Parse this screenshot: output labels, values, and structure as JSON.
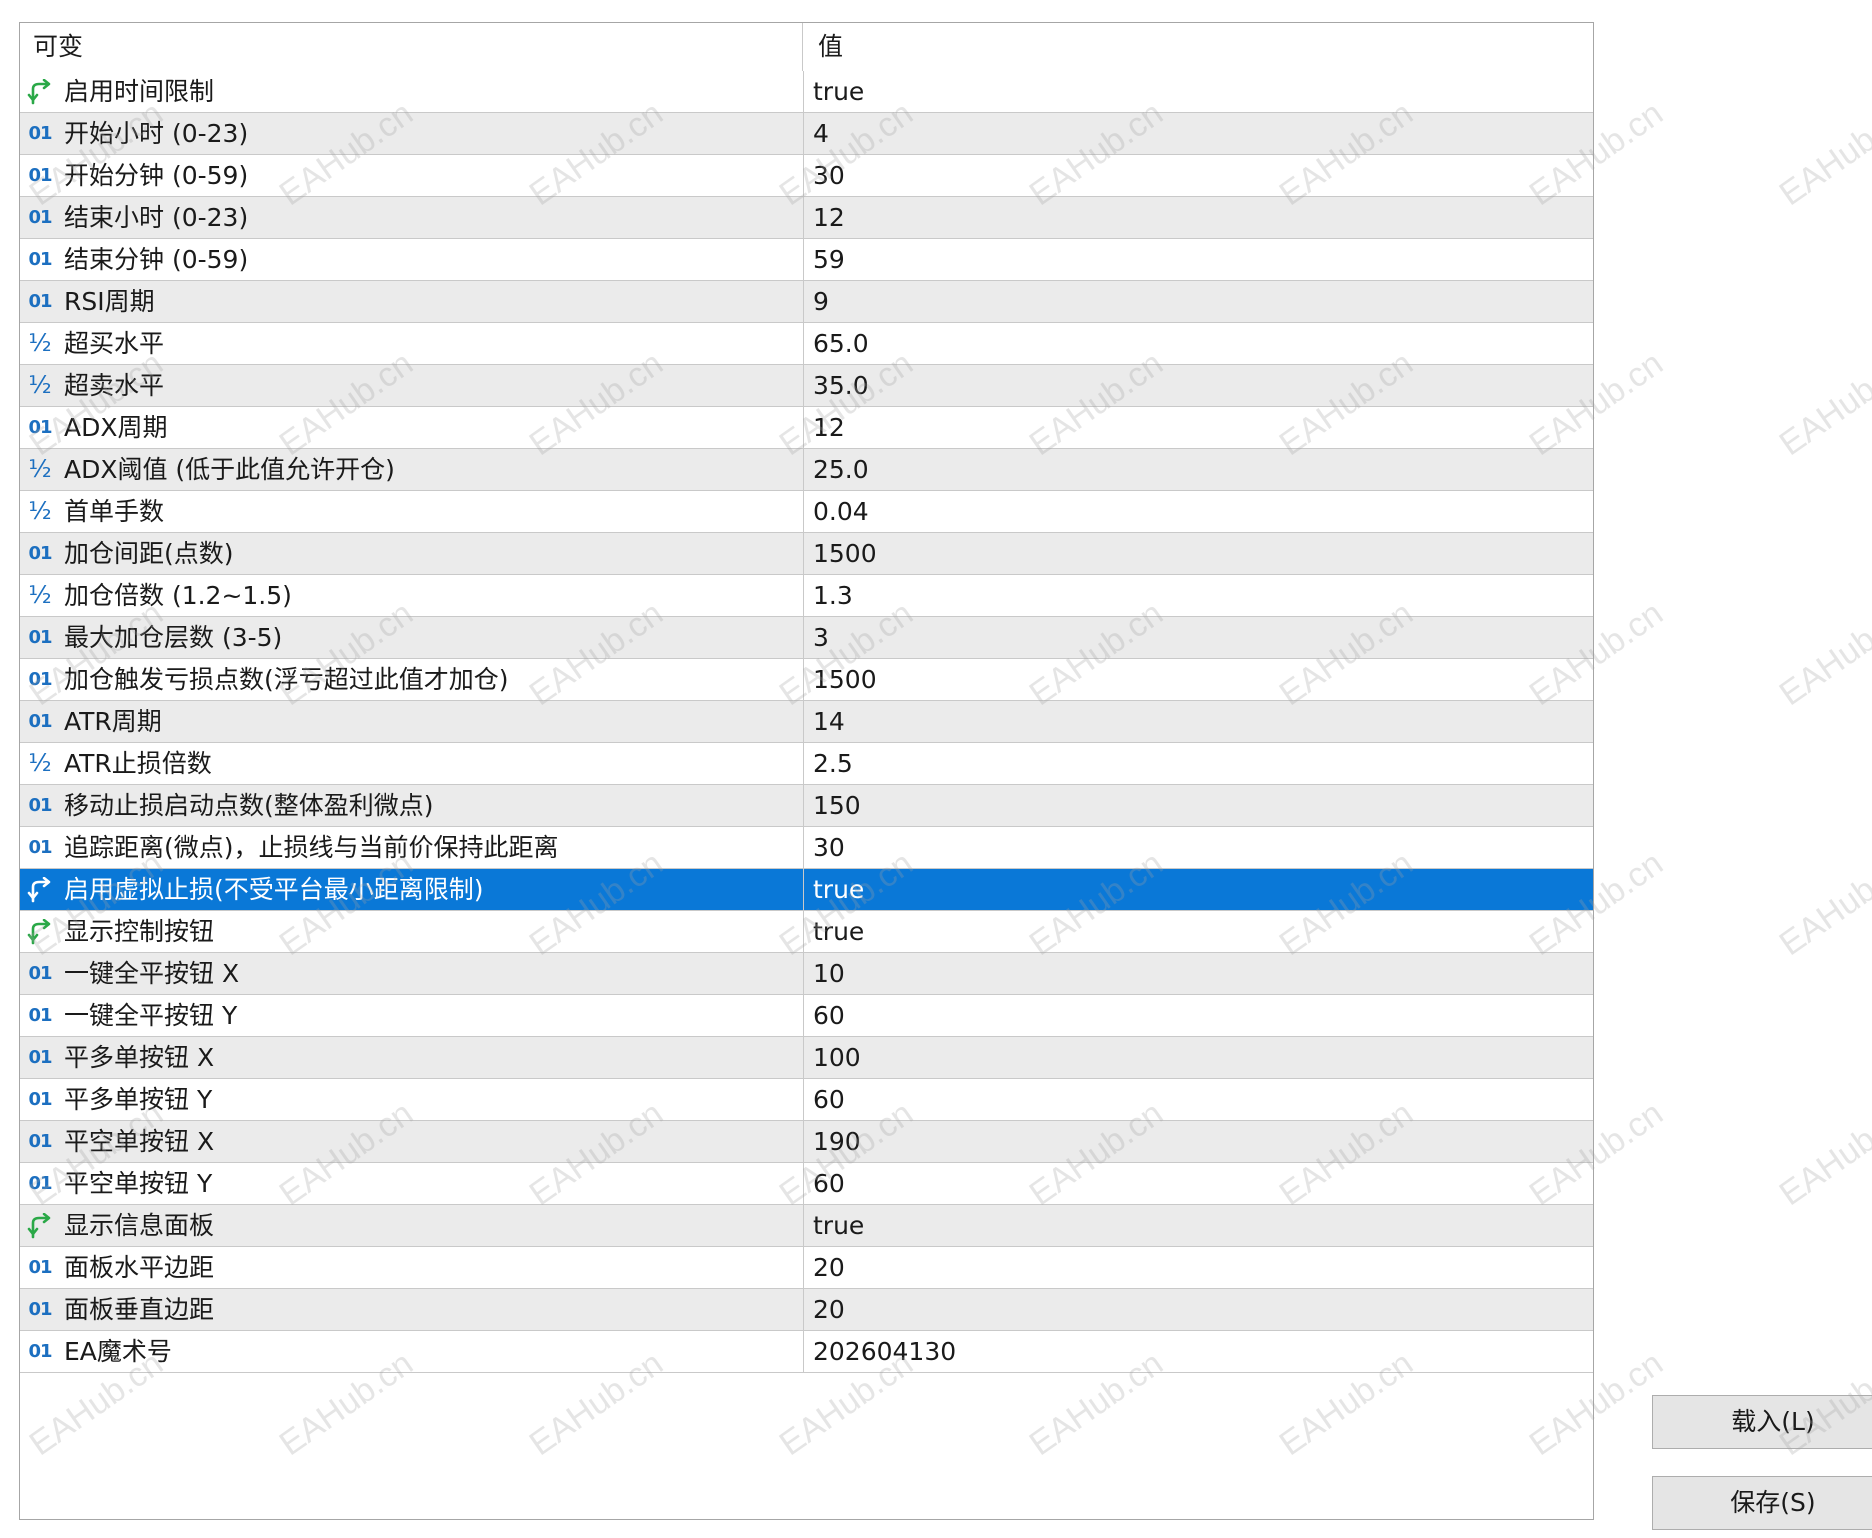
{
  "header": {
    "col_name": "可变",
    "col_value": "值"
  },
  "watermark": "EAHub.cn",
  "colors": {
    "selection": "#0a78d7",
    "alt_row": "#ebebeb",
    "bool_icon": "#2aa847",
    "num_icon": "#1c6fc0"
  },
  "selected_row_index": 19,
  "params": [
    {
      "icon": "bool-icon",
      "name": "启用时间限制",
      "value": "true"
    },
    {
      "icon": "int-icon",
      "name": "开始小时 (0-23)",
      "value": "4"
    },
    {
      "icon": "int-icon",
      "name": "开始分钟 (0-59)",
      "value": "30"
    },
    {
      "icon": "int-icon",
      "name": "结束小时 (0-23)",
      "value": "12"
    },
    {
      "icon": "int-icon",
      "name": "结束分钟 (0-59)",
      "value": "59"
    },
    {
      "icon": "int-icon",
      "name": "RSI周期",
      "value": "9"
    },
    {
      "icon": "double-icon",
      "name": "超买水平",
      "value": "65.0"
    },
    {
      "icon": "double-icon",
      "name": "超卖水平",
      "value": "35.0"
    },
    {
      "icon": "int-icon",
      "name": "ADX周期",
      "value": "12"
    },
    {
      "icon": "double-icon",
      "name": "ADX阈值 (低于此值允许开仓)",
      "value": "25.0"
    },
    {
      "icon": "double-icon",
      "name": "首单手数",
      "value": "0.04"
    },
    {
      "icon": "int-icon",
      "name": "加仓间距(点数)",
      "value": "1500"
    },
    {
      "icon": "double-icon",
      "name": "加仓倍数 (1.2~1.5)",
      "value": "1.3"
    },
    {
      "icon": "int-icon",
      "name": "最大加仓层数 (3-5)",
      "value": "3"
    },
    {
      "icon": "int-icon",
      "name": "加仓触发亏损点数(浮亏超过此值才加仓)",
      "value": "1500"
    },
    {
      "icon": "int-icon",
      "name": "ATR周期",
      "value": "14"
    },
    {
      "icon": "double-icon",
      "name": "ATR止损倍数",
      "value": "2.5"
    },
    {
      "icon": "int-icon",
      "name": "移动止损启动点数(整体盈利微点)",
      "value": "150"
    },
    {
      "icon": "int-icon",
      "name": "追踪距离(微点)，止损线与当前价保持此距离",
      "value": "30"
    },
    {
      "icon": "bool-icon",
      "name": "启用虚拟止损(不受平台最小距离限制)",
      "value": "true"
    },
    {
      "icon": "bool-icon",
      "name": "显示控制按钮",
      "value": "true"
    },
    {
      "icon": "int-icon",
      "name": "一键全平按钮 X",
      "value": "10"
    },
    {
      "icon": "int-icon",
      "name": "一键全平按钮 Y",
      "value": "60"
    },
    {
      "icon": "int-icon",
      "name": "平多单按钮 X",
      "value": "100"
    },
    {
      "icon": "int-icon",
      "name": "平多单按钮 Y",
      "value": "60"
    },
    {
      "icon": "int-icon",
      "name": "平空单按钮 X",
      "value": "190"
    },
    {
      "icon": "int-icon",
      "name": "平空单按钮 Y",
      "value": "60"
    },
    {
      "icon": "bool-icon",
      "name": "显示信息面板",
      "value": "true"
    },
    {
      "icon": "int-icon",
      "name": "面板水平边距",
      "value": "20"
    },
    {
      "icon": "int-icon",
      "name": "面板垂直边距",
      "value": "20"
    },
    {
      "icon": "int-icon",
      "name": "EA魔术号",
      "value": "202604130"
    }
  ],
  "buttons": {
    "load": "载入(L)",
    "save": "保存(S)"
  }
}
